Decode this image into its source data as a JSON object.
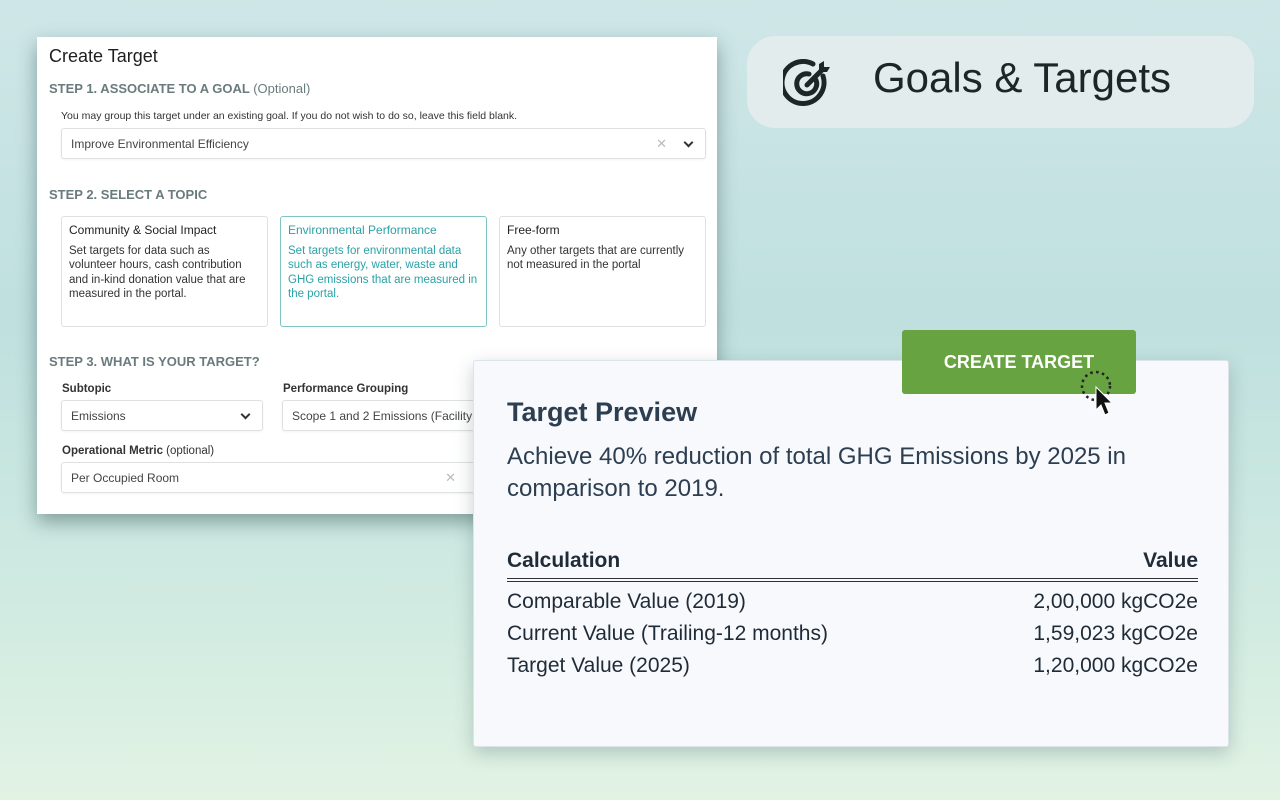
{
  "form": {
    "title": "Create Target",
    "step1": {
      "label": "STEP 1. ASSOCIATE TO A GOAL",
      "optional": "(Optional)",
      "hint": "You may group this target under an existing goal. If you do not wish to do so, leave this field blank.",
      "goal_value": "Improve Environmental Efficiency"
    },
    "step2": {
      "label": "STEP 2. SELECT A TOPIC",
      "topics": [
        {
          "title": "Community & Social Impact",
          "desc": "Set targets for data such as volunteer hours, cash contribution and in-kind donation value that are measured in the portal."
        },
        {
          "title": "Environmental Performance",
          "desc": "Set targets for environmental data such as energy, water, waste and GHG emissions that are measured in the portal.",
          "selected": true
        },
        {
          "title": "Free-form",
          "desc": "Any other targets that are currently not measured in the portal"
        }
      ]
    },
    "step3": {
      "label": "STEP 3. WHAT IS YOUR TARGET?",
      "subtopic_label": "Subtopic",
      "subtopic_value": "Emissions",
      "grouping_label": "Performance Grouping",
      "grouping_value": "Scope 1 and 2 Emissions (Facility",
      "metric_label": "Operational Metric",
      "metric_optional": "(optional)",
      "metric_value": "Per Occupied Room"
    }
  },
  "header": {
    "title": "Goals & Targets",
    "icon": "target-arrow-icon"
  },
  "create_button": "CREATE TARGET",
  "preview": {
    "title": "Target Preview",
    "statement": "Achieve 40% reduction of total GHG Emissions by 2025 in comparison to 2019.",
    "columns": [
      "Calculation",
      "Value"
    ],
    "rows": [
      [
        "Comparable Value (2019)",
        "2,00,000 kgCO2e"
      ],
      [
        "Current Value (Trailing-12 months)",
        "1,59,023 kgCO2e"
      ],
      [
        "Target Value (2025)",
        "1,20,000 kgCO2e"
      ]
    ]
  },
  "colors": {
    "accent_green": "#67a341",
    "teal_selected": "#2aa2a6",
    "heading": "#2d3e50"
  }
}
